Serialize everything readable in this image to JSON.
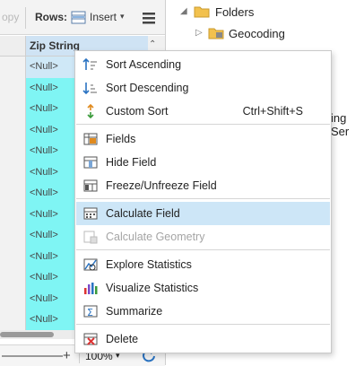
{
  "toolbar": {
    "copy_label": "opy",
    "rows_label": "Rows:",
    "insert_label": "Insert"
  },
  "table": {
    "column_header": "Zip String",
    "cell_value": "<Null>",
    "row_count": 13
  },
  "status": {
    "zoom": "100%"
  },
  "catalog": {
    "folders_label": "Folders",
    "geocoding_label": "Geocoding",
    "cut_text": "ing Ser"
  },
  "menu": {
    "sort_ascending": "Sort Ascending",
    "sort_descending": "Sort Descending",
    "custom_sort": "Custom Sort",
    "custom_sort_shortcut": "Ctrl+Shift+S",
    "fields": "Fields",
    "hide_field": "Hide Field",
    "freeze_field": "Freeze/Unfreeze Field",
    "calculate_field": "Calculate Field",
    "calculate_geometry": "Calculate Geometry",
    "explore_statistics": "Explore Statistics",
    "visualize_statistics": "Visualize Statistics",
    "summarize": "Summarize",
    "delete": "Delete"
  },
  "colors": {
    "highlight": "#cde6f7",
    "cell_cyan": "#7ff5f4",
    "disabled_text": "#a5a5a5"
  }
}
